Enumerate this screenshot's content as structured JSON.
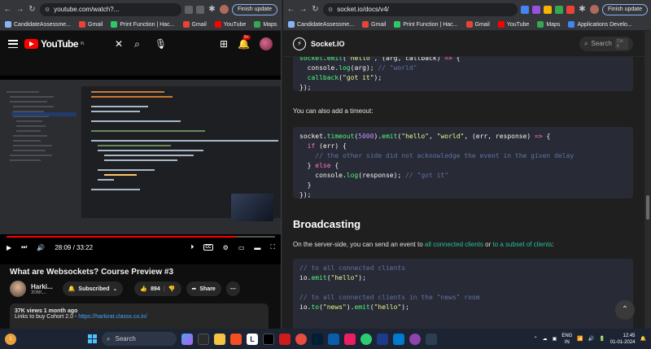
{
  "left_window": {
    "url": "youtube.com/watch?...",
    "update_button": "Finish update",
    "bookmarks": [
      {
        "label": "CandidateAssessme...",
        "color": "#8ab4f8"
      },
      {
        "label": "Gmail",
        "color": "#ea4335"
      },
      {
        "label": "Print Function | Hac...",
        "color": "#2ec866"
      },
      {
        "label": "Gmail",
        "color": "#ea4335"
      },
      {
        "label": "YouTube",
        "color": "#ff0000"
      },
      {
        "label": "Maps",
        "color": "#34a853"
      }
    ],
    "youtube": {
      "logo": "YouTube",
      "region": "IN",
      "notification_count": "9+",
      "player": {
        "time": "28:09 / 33:22",
        "progress": 0.85
      },
      "title": "What are Websockets? Course Preview #3",
      "channel": {
        "name": "Harki...",
        "subscribers": "306K..."
      },
      "subscribed_label": "Subscribed",
      "likes": "894",
      "share_label": "Share",
      "description": {
        "meta": "37K views  1 month ago",
        "text": "Links to buy Cohort 2.0 - ",
        "link": "https://harkirat.classx.co.in/"
      }
    }
  },
  "right_window": {
    "url": "socket.io/docs/v4/",
    "update_button": "Finish update",
    "bookmarks": [
      {
        "label": "CandidateAssessme...",
        "color": "#8ab4f8"
      },
      {
        "label": "Gmail",
        "color": "#ea4335"
      },
      {
        "label": "Print Function | Hac...",
        "color": "#2ec866"
      },
      {
        "label": "Gmail",
        "color": "#ea4335"
      },
      {
        "label": "YouTube",
        "color": "#ff0000"
      },
      {
        "label": "Maps",
        "color": "#34a853"
      },
      {
        "label": "Applications Develo...",
        "color": "#4285f4"
      }
    ],
    "site": {
      "name": "Socket.IO",
      "search_label": "Search",
      "search_shortcut": "Ctrl K",
      "timeout_intro": "You can also add a timeout:",
      "broadcasting_heading": "Broadcasting",
      "broadcast_text": "On the server-side, you can send an event to ",
      "link_all_clients": "all connected clients",
      "or_text": " or ",
      "link_subset": "to a subset of clients",
      "colon": ":"
    }
  },
  "taskbar": {
    "search_label": "Search",
    "lang_top": "ENG",
    "lang_bottom": "IN",
    "time": "12:45",
    "date": "01-01-2024",
    "widget_badge": "1"
  }
}
